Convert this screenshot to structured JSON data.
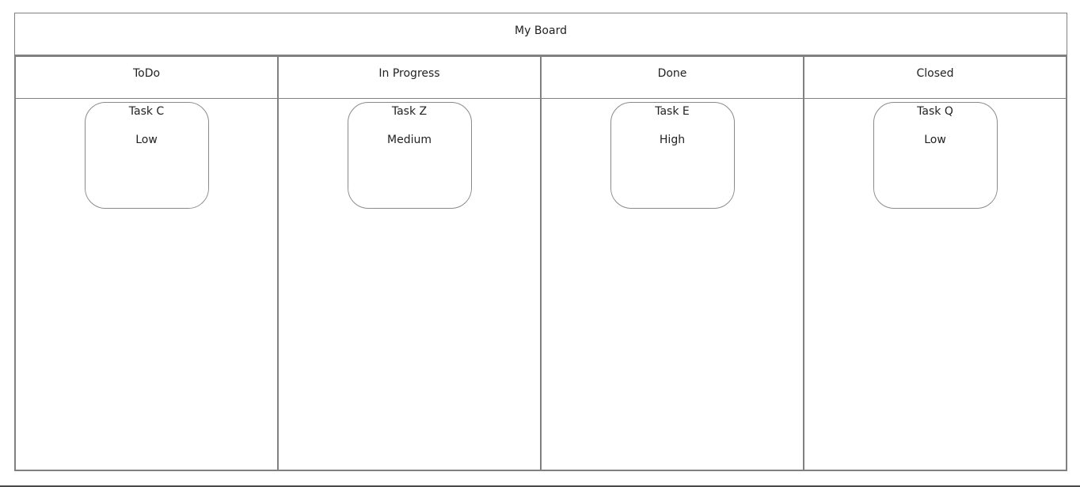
{
  "board": {
    "title": "My Board"
  },
  "columns": [
    {
      "label": "ToDo",
      "cards": [
        {
          "title": "Task C",
          "priority": "Low"
        }
      ]
    },
    {
      "label": "In Progress",
      "cards": [
        {
          "title": "Task Z",
          "priority": "Medium"
        }
      ]
    },
    {
      "label": "Done",
      "cards": [
        {
          "title": "Task E",
          "priority": "High"
        }
      ]
    },
    {
      "label": "Closed",
      "cards": [
        {
          "title": "Task Q",
          "priority": "Low"
        }
      ]
    }
  ],
  "colors": {
    "border": "#808080",
    "background": "#ffffff",
    "text": "#222222"
  }
}
